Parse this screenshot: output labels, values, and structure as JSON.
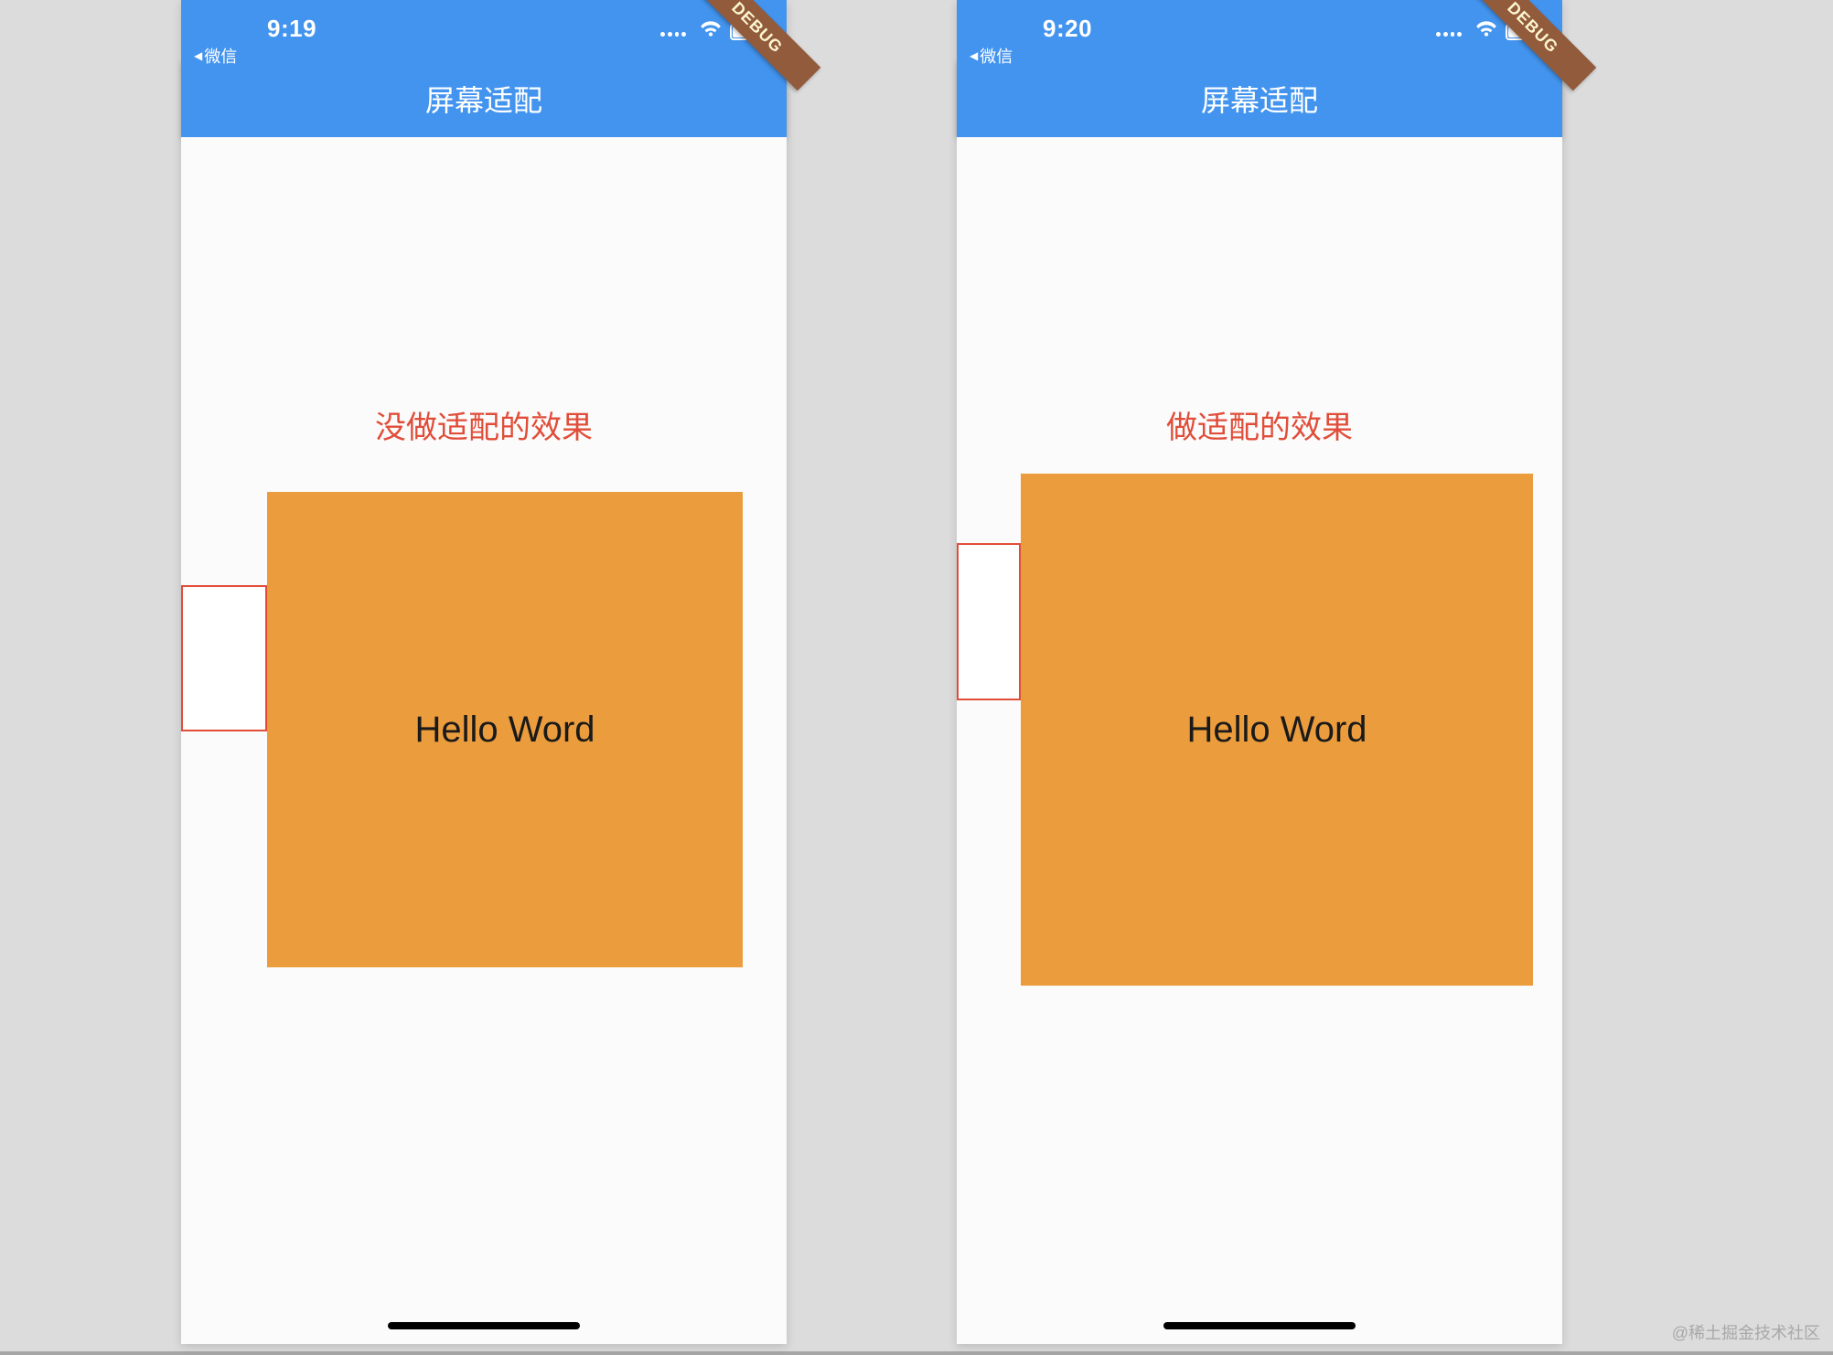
{
  "watermark": "@稀土掘金技术社区",
  "phones": [
    {
      "status": {
        "time": "9:19",
        "back_label": "微信",
        "back_arrow": "◀"
      },
      "appbar": {
        "title": "屏幕适配"
      },
      "debug_banner": "DEBUG",
      "caption": "没做适配的效果",
      "box_text": "Hello Word"
    },
    {
      "status": {
        "time": "9:20",
        "back_label": "微信",
        "back_arrow": "◀"
      },
      "appbar": {
        "title": "屏幕适配"
      },
      "debug_banner": "DEBUG",
      "caption": "做适配的效果",
      "box_text": "Hello Word"
    }
  ]
}
